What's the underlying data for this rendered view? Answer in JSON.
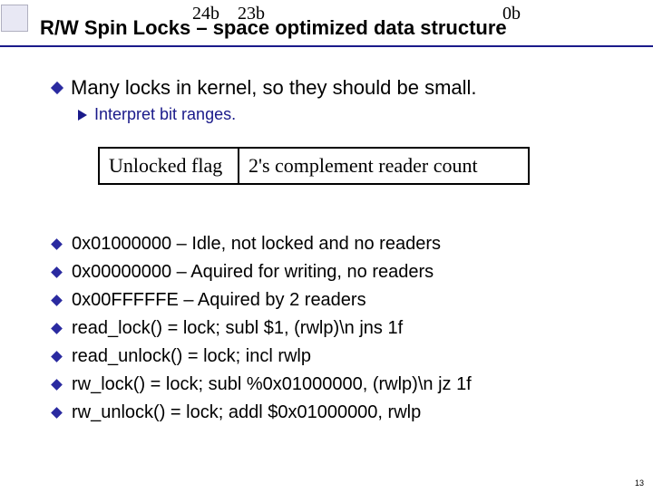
{
  "slide": {
    "title": "R/W Spin Locks – space optimized data structure",
    "page_number": "13"
  },
  "main_bullet": {
    "text": "Many locks in kernel, so they should be small.",
    "sub": "Interpret bit ranges."
  },
  "bitbox": {
    "left": "Unlocked flag",
    "right": "2's complement reader count",
    "label_24": "24b",
    "label_23": "23b",
    "label_0": "0b"
  },
  "items": [
    "0x01000000 – Idle, not locked and no readers",
    "0x00000000 – Aquired for writing, no readers",
    "0x00FFFFFE – Aquired by 2 readers",
    "read_lock() = lock; subl $1, (rwlp)\\n jns 1f",
    "read_unlock() = lock; incl rwlp",
    "rw_lock() = lock; subl %0x01000000, (rwlp)\\n jz 1f",
    "rw_unlock() = lock; addl $0x01000000, rwlp"
  ]
}
